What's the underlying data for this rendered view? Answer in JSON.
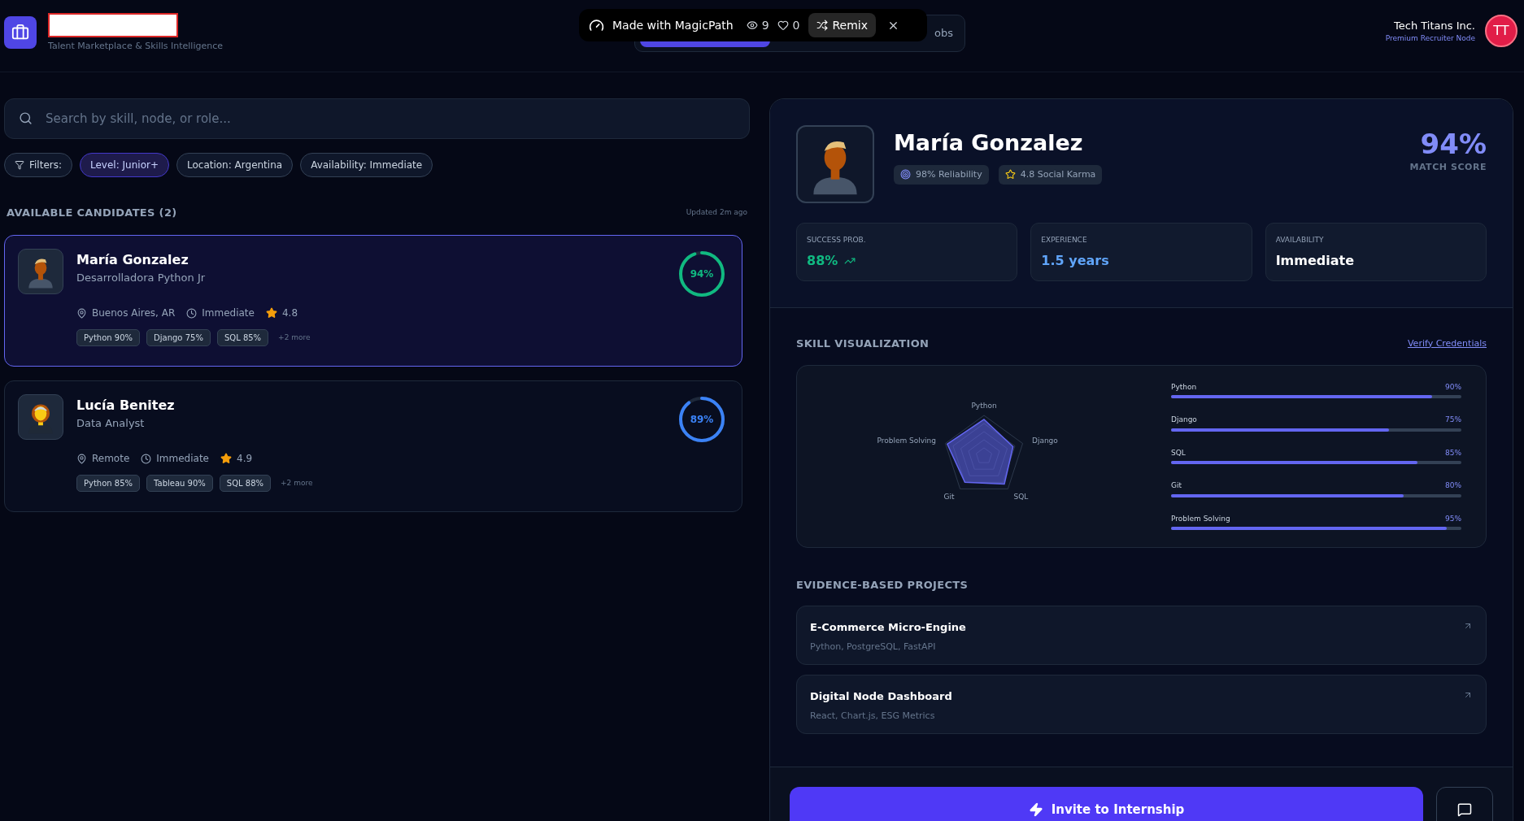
{
  "header": {
    "subtitle": "Talent Marketplace & Skills Intelligence",
    "company": "Tech Titans Inc.",
    "plan": "Premium Recruiter Node",
    "avatar_initials": "TT"
  },
  "tabs": [
    {
      "selected": true
    },
    {
      "label": "obs",
      "selected": false
    }
  ],
  "badge_bar": {
    "label": "Made with MagicPath",
    "views": "9",
    "likes": "0",
    "remix": "Remix"
  },
  "search": {
    "placeholder": "Search by skill, node, or role..."
  },
  "filters": [
    {
      "label": "Filters:",
      "kind": "menu",
      "selected": false
    },
    {
      "label": "Level: Junior+",
      "kind": "chip",
      "selected": true
    },
    {
      "label": "Location: Argentina",
      "kind": "chip",
      "selected": false
    },
    {
      "label": "Availability: Immediate",
      "kind": "chip",
      "selected": false
    }
  ],
  "candidates_heading": "AVAILABLE CANDIDATES (2)",
  "updated": "Updated 2m ago",
  "candidates": [
    {
      "name": "María Gonzalez",
      "role": "Desarrolladora Python Jr",
      "location": "Buenos Aires, AR",
      "availability": "Immediate",
      "rating": "4.8",
      "match": "94%",
      "level": 0.94,
      "color": "#10b981",
      "selected": true,
      "skills": [
        "Python 90%",
        "Django 75%",
        "SQL 85%"
      ],
      "more": "+2 more"
    },
    {
      "name": "Lucía Benitez",
      "role": "Data Analyst",
      "location": "Remote",
      "availability": "Immediate",
      "rating": "4.9",
      "match": "89%",
      "level": 0.89,
      "color": "#3b82f6",
      "selected": false,
      "skills": [
        "Python 85%",
        "Tableau 90%",
        "SQL 88%"
      ],
      "more": "+2 more"
    }
  ],
  "profile": {
    "name": "María Gonzalez",
    "reliability": "98% Reliability",
    "karma": "4.8 Social Karma",
    "match": "94%",
    "match_label": "MATCH SCORE",
    "stats": [
      {
        "label": "SUCCESS PROB.",
        "value": "88%",
        "kind": "trend"
      },
      {
        "label": "EXPERIENCE",
        "value": "1.5 years",
        "kind": "accent"
      },
      {
        "label": "AVAILABILITY",
        "value": "Immediate",
        "kind": "plain"
      }
    ],
    "skills_heading": "SKILL VISUALIZATION",
    "verify": "Verify Credentials",
    "skills": [
      {
        "name": "Python",
        "reading": "90%",
        "level": 0.9
      },
      {
        "name": "Django",
        "reading": "75%",
        "level": 0.75
      },
      {
        "name": "SQL",
        "reading": "85%",
        "level": 0.85
      },
      {
        "name": "Git",
        "reading": "80%",
        "level": 0.8
      },
      {
        "name": "Problem Solving",
        "reading": "95%",
        "level": 0.95
      }
    ],
    "radar_labels": [
      "Python",
      "Django",
      "SQL",
      "Git",
      "Problem Solving"
    ],
    "projects_heading": "EVIDENCE-BASED PROJECTS",
    "projects": [
      {
        "title": "E-Commerce Micro-Engine",
        "stack": "Python, PostgreSQL, FastAPI"
      },
      {
        "title": "Digital Node Dashboard",
        "stack": "React, Chart.js, ESG Metrics"
      }
    ],
    "invite": "Invite to Internship"
  }
}
